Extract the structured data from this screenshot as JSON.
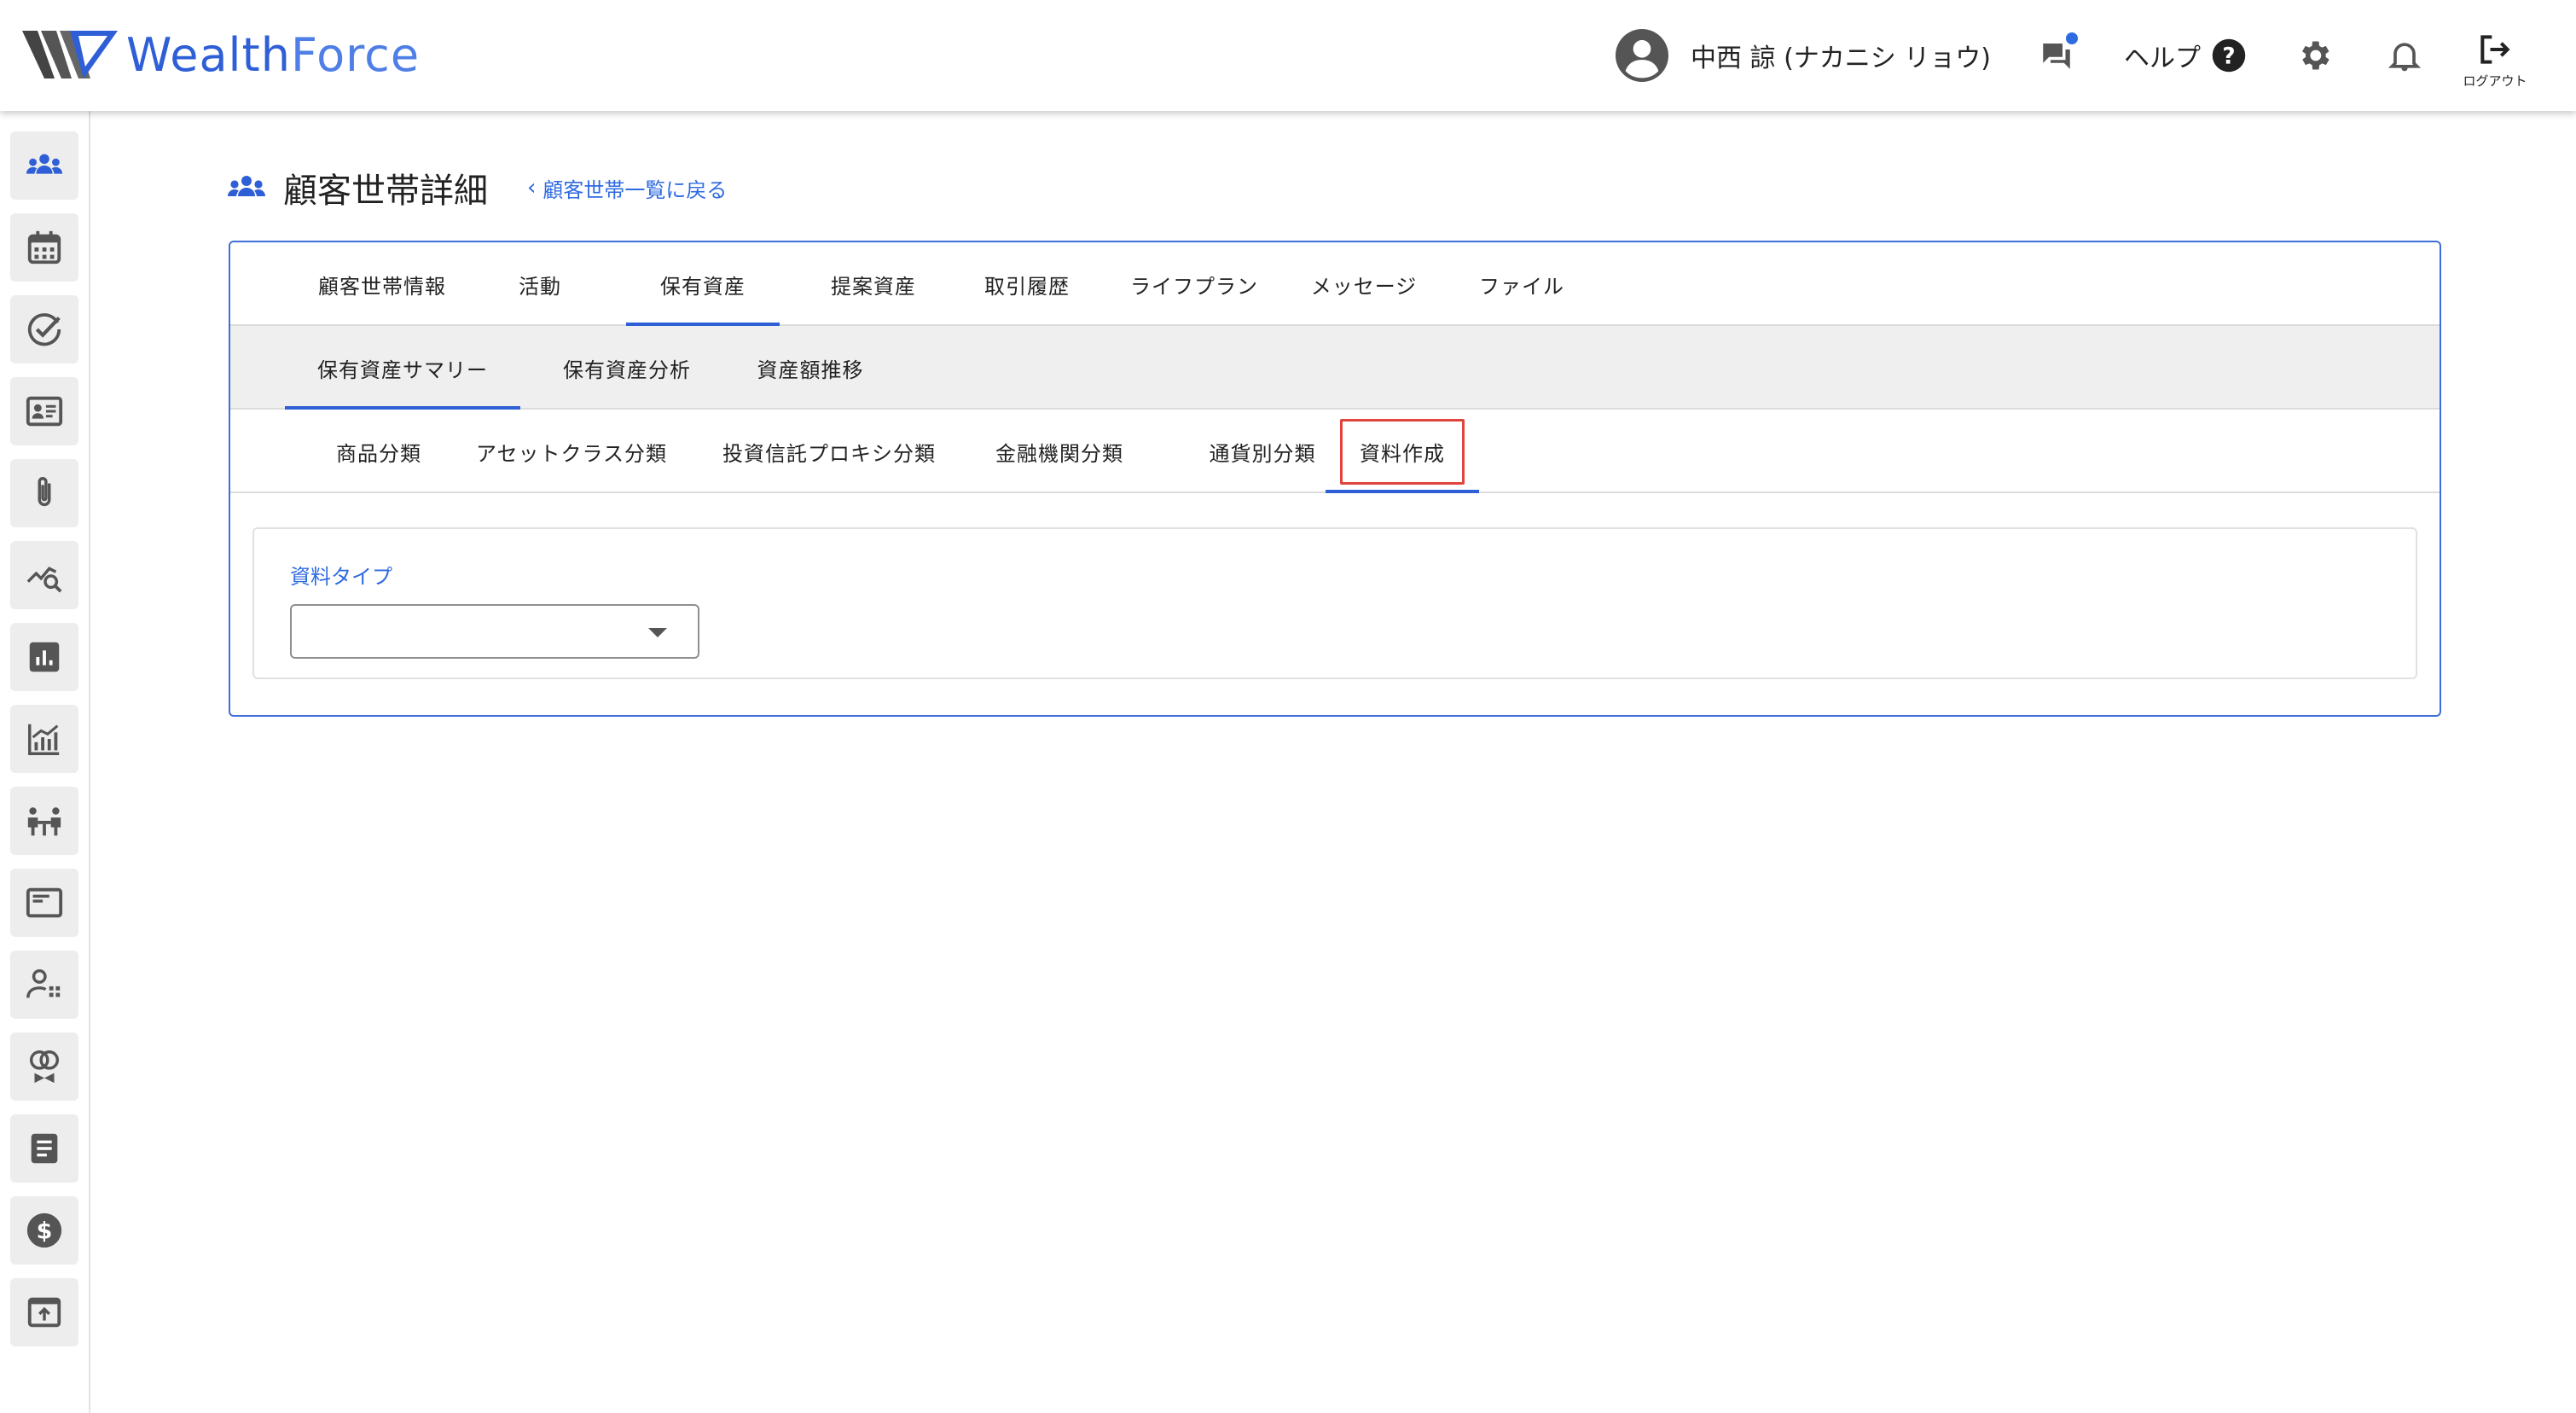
{
  "app": {
    "logo_text_a": "Wealth",
    "logo_text_b": "Force",
    "brand_color": "#2f5fd6"
  },
  "header": {
    "user_name": "中西 諒 (ナカニシ リョウ)",
    "help_label": "ヘルプ",
    "logout_label": "ログアウト",
    "icons": [
      "account-circle-icon",
      "chat-icon",
      "help-circle-icon",
      "gear-icon",
      "bell-icon",
      "logout-icon"
    ]
  },
  "sidebar": {
    "items": [
      {
        "icon": "household-icon",
        "active": true
      },
      {
        "icon": "calendar-icon"
      },
      {
        "icon": "check-circle-icon"
      },
      {
        "icon": "contact-card-icon"
      },
      {
        "icon": "paperclip-icon"
      },
      {
        "icon": "analytics-search-icon"
      },
      {
        "icon": "bar-chart-icon"
      },
      {
        "icon": "growth-chart-icon"
      },
      {
        "icon": "meeting-icon"
      },
      {
        "icon": "document-frame-icon"
      },
      {
        "icon": "person-stats-icon"
      },
      {
        "icon": "rings-icon"
      },
      {
        "icon": "list-document-icon"
      },
      {
        "icon": "dollar-icon"
      },
      {
        "icon": "upload-box-icon"
      }
    ]
  },
  "page": {
    "title": "顧客世帯詳細",
    "back_link": "顧客世帯一覧に戻る"
  },
  "tabs_primary": [
    {
      "label": "顧客世帯情報"
    },
    {
      "label": "活動"
    },
    {
      "label": "保有資産",
      "active": true
    },
    {
      "label": "提案資産"
    },
    {
      "label": "取引履歴"
    },
    {
      "label": "ライフプラン"
    },
    {
      "label": "メッセージ"
    },
    {
      "label": "ファイル"
    }
  ],
  "tabs_secondary": [
    {
      "label": "保有資産サマリー",
      "active": true
    },
    {
      "label": "保有資産分析"
    },
    {
      "label": "資産額推移"
    }
  ],
  "tabs_tertiary": [
    {
      "label": "商品分類"
    },
    {
      "label": "アセットクラス分類"
    },
    {
      "label": "投資信託プロキシ分類"
    },
    {
      "label": "金融機関分類"
    },
    {
      "label": "通貨別分類"
    },
    {
      "label": "資料作成",
      "active": true
    }
  ],
  "form": {
    "doc_type_label": "資料タイプ",
    "doc_type_value": ""
  }
}
